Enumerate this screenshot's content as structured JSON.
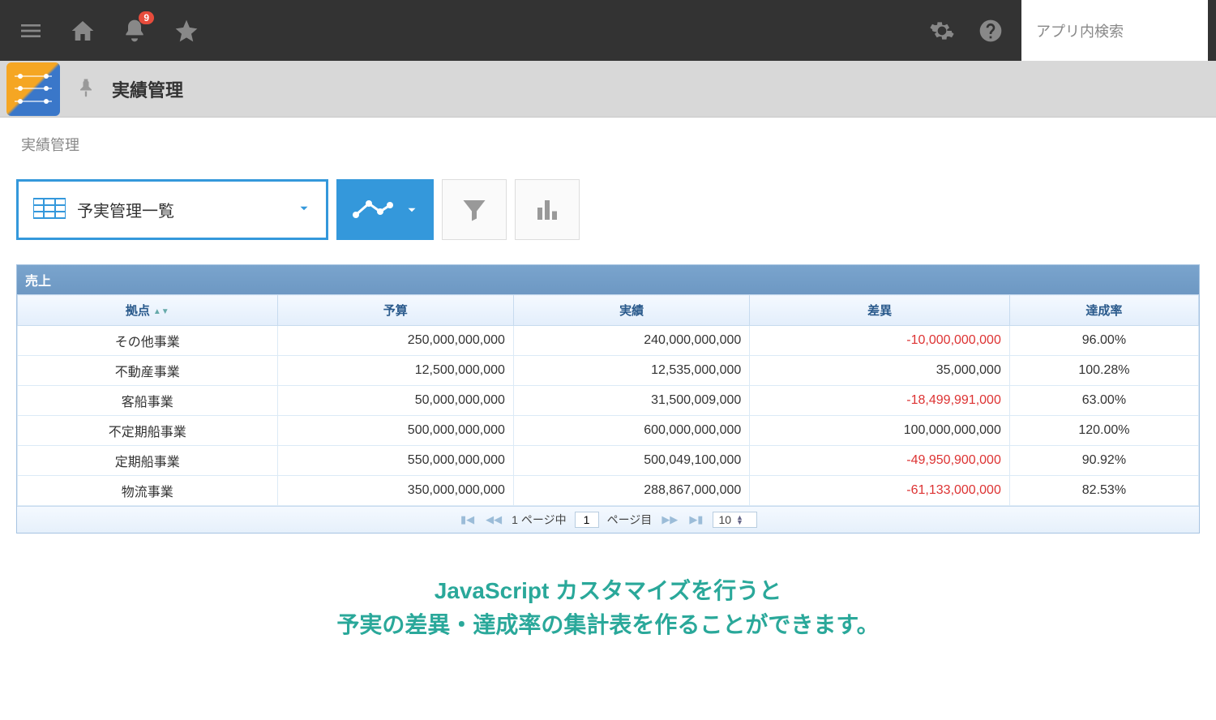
{
  "topbar": {
    "notification_count": "9",
    "search_placeholder": "アプリ内検索"
  },
  "app": {
    "title": "実績管理"
  },
  "breadcrumb": "実績管理",
  "view": {
    "dropdown_label": "予実管理一覧"
  },
  "table": {
    "title": "売上",
    "columns": {
      "location": "拠点",
      "budget": "予算",
      "actual": "実績",
      "diff": "差異",
      "rate": "達成率"
    },
    "rows": [
      {
        "location": "その他事業",
        "budget": "250,000,000,000",
        "actual": "240,000,000,000",
        "diff": "-10,000,000,000",
        "diff_neg": true,
        "rate": "96.00%"
      },
      {
        "location": "不動産事業",
        "budget": "12,500,000,000",
        "actual": "12,535,000,000",
        "diff": "35,000,000",
        "diff_neg": false,
        "rate": "100.28%"
      },
      {
        "location": "客船事業",
        "budget": "50,000,000,000",
        "actual": "31,500,009,000",
        "diff": "-18,499,991,000",
        "diff_neg": true,
        "rate": "63.00%"
      },
      {
        "location": "不定期船事業",
        "budget": "500,000,000,000",
        "actual": "600,000,000,000",
        "diff": "100,000,000,000",
        "diff_neg": false,
        "rate": "120.00%"
      },
      {
        "location": "定期船事業",
        "budget": "550,000,000,000",
        "actual": "500,049,100,000",
        "diff": "-49,950,900,000",
        "diff_neg": true,
        "rate": "90.92%"
      },
      {
        "location": "物流事業",
        "budget": "350,000,000,000",
        "actual": "288,867,000,000",
        "diff": "-61,133,000,000",
        "diff_neg": true,
        "rate": "82.53%"
      }
    ]
  },
  "pager": {
    "total_pages_text": "1 ページ中",
    "current_page": "1",
    "page_suffix": "ページ目",
    "page_size": "10"
  },
  "caption": {
    "line1": "JavaScript カスタマイズを行うと",
    "line2": "予実の差異・達成率の集計表を作ることができます。"
  }
}
